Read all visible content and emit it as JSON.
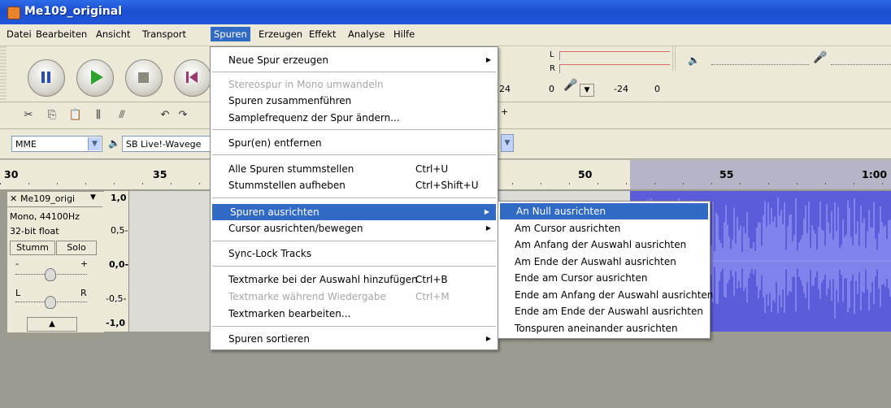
{
  "window": {
    "title": "Me109_original"
  },
  "menubar": {
    "items": [
      "Datei",
      "Bearbeiten",
      "Ansicht",
      "Transport",
      "Spuren",
      "Erzeugen",
      "Effekt",
      "Analyse",
      "Hilfe"
    ],
    "active": "Spuren"
  },
  "toolbar": {
    "meter_labels": {
      "l": "L",
      "r": "R"
    },
    "meter_ticks": [
      "24",
      "0",
      "-24",
      "0"
    ],
    "device": {
      "host": "MME",
      "output": "SB Live!-Wavege"
    }
  },
  "ruler": {
    "labels": [
      "30",
      "35",
      "50",
      "55",
      "1:00"
    ]
  },
  "track": {
    "name": "Me109_origi",
    "info1": "Mono, 44100Hz",
    "info2": "32-bit float",
    "mute_label": "Stumm",
    "solo_label": "Solo",
    "gain_minus": "-",
    "gain_plus": "+",
    "pan_left": "L",
    "pan_right": "R",
    "scale": [
      "1,0",
      "0,5-",
      "0,0-",
      "-0,5-",
      "-1,0"
    ]
  },
  "spuren_menu": {
    "items": [
      {
        "label": "Neue Spur erzeugen",
        "submenu": true
      },
      {
        "label": "Stereospur in Mono umwandeln",
        "disabled": true
      },
      {
        "label": "Spuren zusammenführen"
      },
      {
        "label": "Samplefrequenz der Spur ändern..."
      },
      {
        "label": "Spur(en) entfernen"
      },
      {
        "label": "Alle Spuren stummstellen",
        "shortcut": "Ctrl+U"
      },
      {
        "label": "Stummstellen aufheben",
        "shortcut": "Ctrl+Shift+U"
      },
      {
        "label": "Spuren ausrichten",
        "submenu": true,
        "highlighted": true
      },
      {
        "label": "Cursor ausrichten/bewegen",
        "submenu": true
      },
      {
        "label": "Sync-Lock Tracks"
      },
      {
        "label": "Textmarke bei der Auswahl hinzufügen",
        "shortcut": "Ctrl+B"
      },
      {
        "label": "Textmarke während Wiedergabe",
        "shortcut": "Ctrl+M",
        "disabled": true
      },
      {
        "label": "Textmarken bearbeiten..."
      },
      {
        "label": "Spuren sortieren",
        "submenu": true
      }
    ]
  },
  "align_submenu": {
    "items": [
      "An Null ausrichten",
      "Am Cursor ausrichten",
      "Am Anfang der Auswahl ausrichten",
      "Am Ende der Auswahl ausrichten",
      "Ende am Cursor ausrichten",
      "Ende am Anfang der Auswahl ausrichten",
      "Ende am Ende der Auswahl ausrichten",
      "Tonspuren aneinander ausrichten"
    ],
    "highlighted": "An Null ausrichten"
  },
  "colors": {
    "titlebar": "#1f55d8",
    "menu_highlight": "#316ac5",
    "waveform": "#5b5cd9",
    "chrome": "#ece9d8"
  }
}
